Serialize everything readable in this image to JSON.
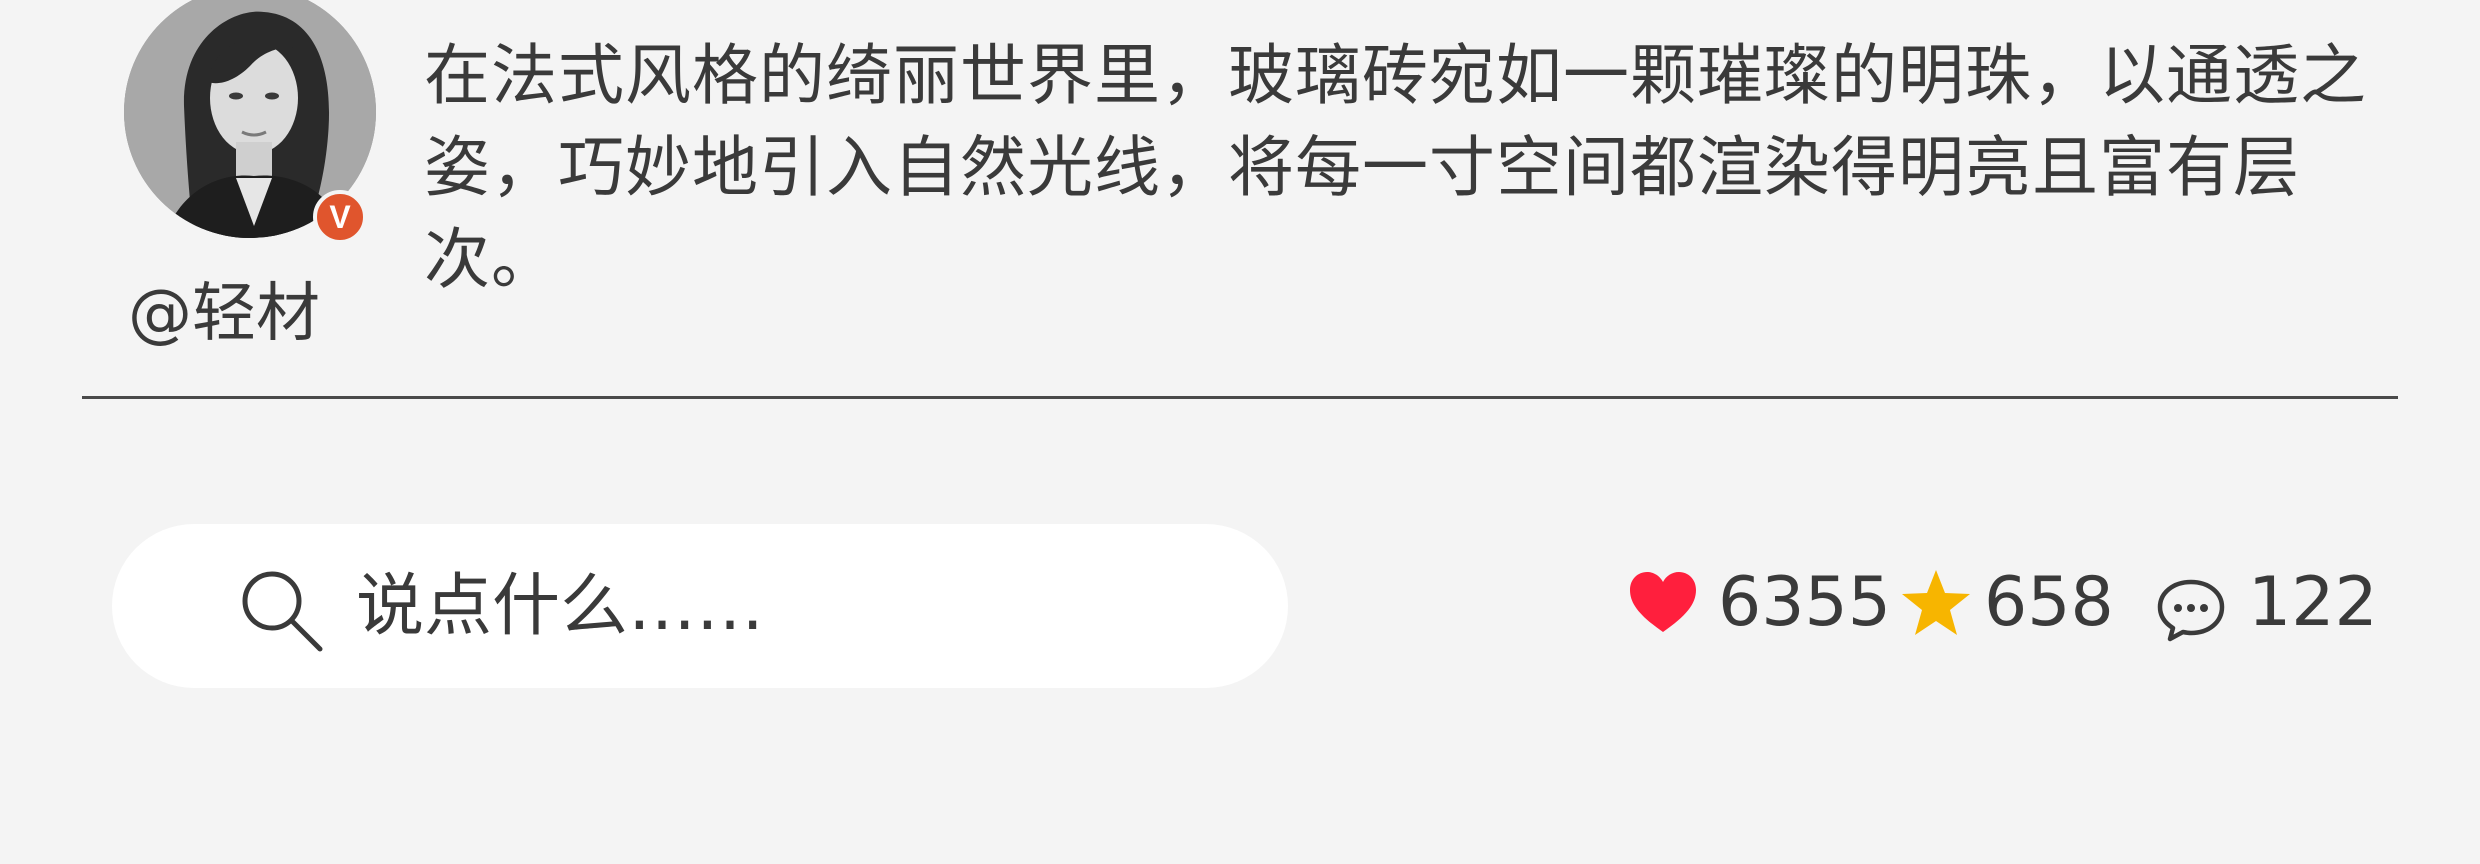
{
  "post": {
    "author": "@轻材",
    "caption": "在法式风格的绮丽世界里，玻璃砖宛如一颗璀璨的明珠，以通透之姿，巧妙地引入自然光线，将每一寸空间都渲染得明亮且富有层次。",
    "verified_badge": "V"
  },
  "comment": {
    "placeholder": "说点什么……"
  },
  "stats": {
    "likes": "6355",
    "favorites": "658",
    "comments": "122"
  },
  "colors": {
    "like": "#ff1f3d",
    "favorite": "#f7b500",
    "badge": "#e0552d",
    "background": "#f4f4f4"
  }
}
